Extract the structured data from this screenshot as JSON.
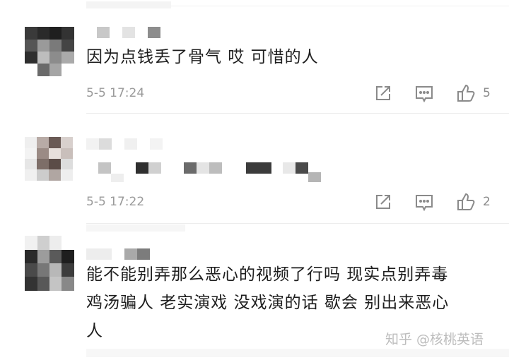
{
  "comments": [
    {
      "text": "因为点钱丢了骨气  哎 可惜的人",
      "time": "5-5 17:24",
      "likes": "5"
    },
    {
      "text": "",
      "time": "5-5 17:22",
      "likes": "2"
    },
    {
      "text_line1": "能不能别弄那么恶心的视频了行吗 现实点别弄毒",
      "text_line2": "鸡汤骗人  老实演戏 没戏演的话 歇会 别出来恶心",
      "text_line3": "人"
    }
  ],
  "watermark": "知乎 @核桃英语",
  "icons": [
    "share-icon",
    "comment-icon",
    "like-icon"
  ],
  "colors": {
    "text": "#1e1e1e",
    "meta": "#9a9a9a",
    "icon": "#8a8a8a",
    "divider": "#ececec"
  }
}
